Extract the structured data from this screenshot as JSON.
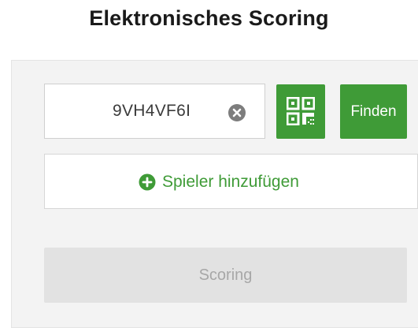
{
  "page": {
    "title": "Elektronisches Scoring"
  },
  "code_input": {
    "value": "9VH4VF6I",
    "clear_icon": "close-circle-icon"
  },
  "qr_button": {
    "icon": "qr-code-icon"
  },
  "find_button": {
    "label": "Finden"
  },
  "add_player": {
    "icon": "plus-circle-icon",
    "label": "Spieler hinzufügen"
  },
  "scoring_button": {
    "label": "Scoring",
    "disabled": true
  },
  "colors": {
    "accent": "#3f9b37",
    "disabled_bg": "#e2e2e2",
    "disabled_text": "#a7a7a7",
    "panel_bg": "#f3f3f3"
  }
}
